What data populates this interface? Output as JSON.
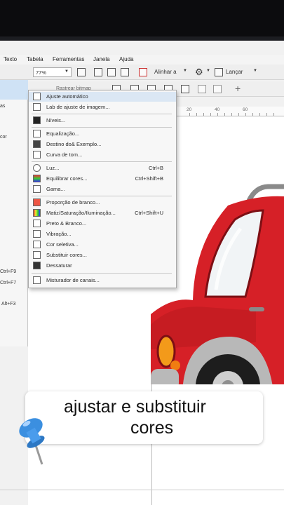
{
  "menubar": {
    "items": [
      "Texto",
      "Tabela",
      "Ferramentas",
      "Janela",
      "Ajuda"
    ]
  },
  "toolbar": {
    "zoom": "77%",
    "align_label": "Alinhar a",
    "launch_label": "Lançar",
    "bitmap_label": "Rastrear bitmap"
  },
  "left_panel": {
    "items": [
      "as",
      "cor"
    ],
    "shortcuts": [
      "Ctrl+F9",
      "Ctrl+F7",
      "Alt+F3"
    ]
  },
  "ruler": {
    "ticks": [
      "20",
      "40",
      "60"
    ]
  },
  "menu": {
    "items": [
      {
        "label": "Ajuste automático",
        "shortcut": "",
        "icon": "auto-adjust-icon"
      },
      {
        "label": "Lab de ajuste de imagem...",
        "shortcut": "",
        "icon": "image-lab-icon"
      },
      {
        "label": "Níveis...",
        "shortcut": "",
        "icon": "levels-icon"
      },
      {
        "label": "Equalização...",
        "shortcut": "",
        "icon": "equalization-icon"
      },
      {
        "label": "Destino do& Exemplo...",
        "shortcut": "",
        "icon": "sample-target-icon"
      },
      {
        "label": "Curva de tom...",
        "shortcut": "",
        "icon": "tone-curve-icon"
      },
      {
        "label": "Luz...",
        "shortcut": "Ctrl+B",
        "icon": "light-icon"
      },
      {
        "label": "Equilibrar cores...",
        "shortcut": "Ctrl+Shift+B",
        "icon": "color-balance-icon"
      },
      {
        "label": "Gama...",
        "shortcut": "",
        "icon": "gamma-icon"
      },
      {
        "label": "Proporção de branco...",
        "shortcut": "",
        "icon": "white-balance-icon"
      },
      {
        "label": "Matiz/Saturação/Iluminação...",
        "shortcut": "Ctrl+Shift+U",
        "icon": "hue-saturation-icon"
      },
      {
        "label": "Preto & Branco...",
        "shortcut": "",
        "icon": "black-white-icon"
      },
      {
        "label": "Vibração...",
        "shortcut": "",
        "icon": "vibrance-icon"
      },
      {
        "label": "Cor seletiva...",
        "shortcut": "",
        "icon": "selective-color-icon"
      },
      {
        "label": "Substituir cores...",
        "shortcut": "",
        "icon": "replace-colors-icon"
      },
      {
        "label": "Dessaturar",
        "shortcut": "",
        "icon": "desaturate-icon"
      },
      {
        "label": "Misturador de canais...",
        "shortcut": "",
        "icon": "channel-mixer-icon"
      }
    ]
  },
  "caption": {
    "line1": "ajustar e substituir",
    "line2": "cores"
  },
  "colors": {
    "car_body": "#d62027",
    "car_dark": "#8e1116",
    "menu_highlight": "#dbe7f4",
    "pin_blue": "#3b8fe0"
  }
}
